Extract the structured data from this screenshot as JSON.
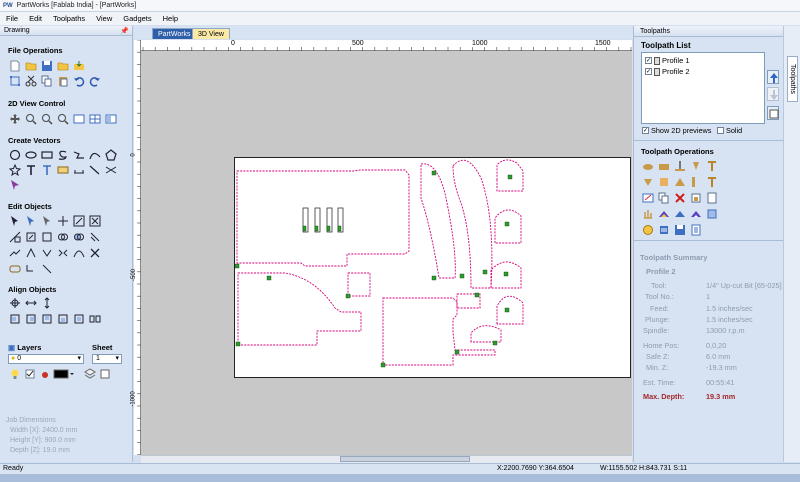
{
  "window": {
    "title": "PartWorks [Fablab India] - [PartWorks]",
    "logo": "PW"
  },
  "menu": [
    "File",
    "Edit",
    "Toolpaths",
    "View",
    "Gadgets",
    "Help"
  ],
  "left_panel": {
    "header": "Drawing",
    "pin_icon": "pin-icon",
    "sections": {
      "file_operations": "File Operations",
      "view_control": "2D View Control",
      "create_vectors": "Create Vectors",
      "edit_objects": "Edit Objects",
      "align_objects": "Align Objects",
      "layers": "Layers",
      "sheet": "Sheet"
    },
    "layer_value": "0",
    "sheet_value": "1",
    "job_dimensions": {
      "title": "Job Dimensions",
      "width": "Width  [X]: 2400.0 mm",
      "height": "Height [Y]: 900.0 mm",
      "depth": "Depth  [Z]: 19.0 mm"
    }
  },
  "doc_tabs": [
    "PartWorks",
    "3D View"
  ],
  "ruler": {
    "top": [
      "0",
      "500",
      "1000",
      "1500"
    ],
    "left": [
      "0",
      "-500",
      "-1000"
    ]
  },
  "right_panel": {
    "header": "Toolpaths",
    "list_title": "Toolpath List",
    "items": [
      {
        "label": "Profile 1",
        "checked": true
      },
      {
        "label": "Profile 2",
        "checked": true
      }
    ],
    "show_2d_previews": "Show 2D previews",
    "solid": "Solid",
    "operations_title": "Toolpath Operations",
    "summary_title": "Toolpath Summary",
    "summary_name": "Profile 2",
    "summary": {
      "tool_label": "Tool:",
      "tool_value": "1/4\" Up-cut Bit [65-025]",
      "toolno_label": "Tool No.:",
      "toolno_value": "1",
      "feed_label": "Feed:",
      "feed_value": "1.5 inches/sec",
      "plunge_label": "Plunge:",
      "plunge_value": "1.5 inches/sec",
      "spindle_label": "Spindle:",
      "spindle_value": "13000 r.p.m",
      "home_label": "Home Pos:",
      "home_value": "0,0,20",
      "safez_label": "Safe Z:",
      "safez_value": "6.0 mm",
      "minz_label": "Min. Z:",
      "minz_value": "-19.3 mm",
      "time_label": "Est. Time:",
      "time_value": "00:55:41",
      "maxdepth_label": "Max. Depth:",
      "maxdepth_value": "19.3 mm"
    },
    "side_tab": "Toolpaths"
  },
  "status": {
    "left": "Ready",
    "coords": "X:2200.7690 Y:364.6504",
    "dims": "W:1155.502   H:843.731   S:11"
  },
  "colors": {
    "toolpath": "#d6007a",
    "node": "#2e9b2e",
    "accent": "#c00000"
  }
}
